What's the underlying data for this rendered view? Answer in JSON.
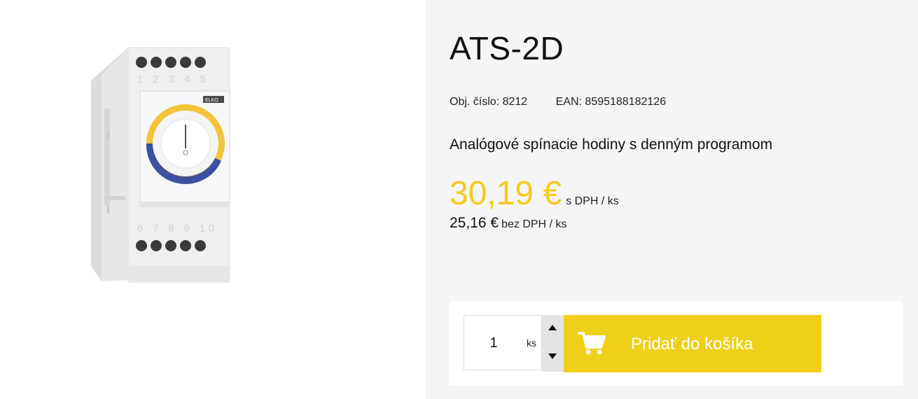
{
  "product": {
    "title": "ATS-2D",
    "order_number": "Obj. číslo: 8212",
    "ean": "EAN: 8595188182126",
    "description": "Analógové spínacie hodiny s denným programom",
    "image": {
      "brand_mark": "ELKO",
      "terminals_top": [
        "1",
        "2",
        "3",
        "4",
        "5"
      ],
      "terminals_bottom": [
        "6",
        "7",
        "8",
        "9",
        "10"
      ]
    }
  },
  "price": {
    "with_vat": "30,19 €",
    "with_vat_unit": "s DPH / ks",
    "without_vat": "25,16 €",
    "without_vat_unit": "bez DPH / ks",
    "accent_color": "#f2cc1e"
  },
  "cart": {
    "quantity": "1",
    "unit": "ks",
    "add_label": "Pridať do košíka",
    "button_color": "#f0cf19",
    "icons": {
      "increment": "triangle-up-icon",
      "decrement": "triangle-down-icon",
      "cart": "shopping-cart-icon"
    }
  }
}
